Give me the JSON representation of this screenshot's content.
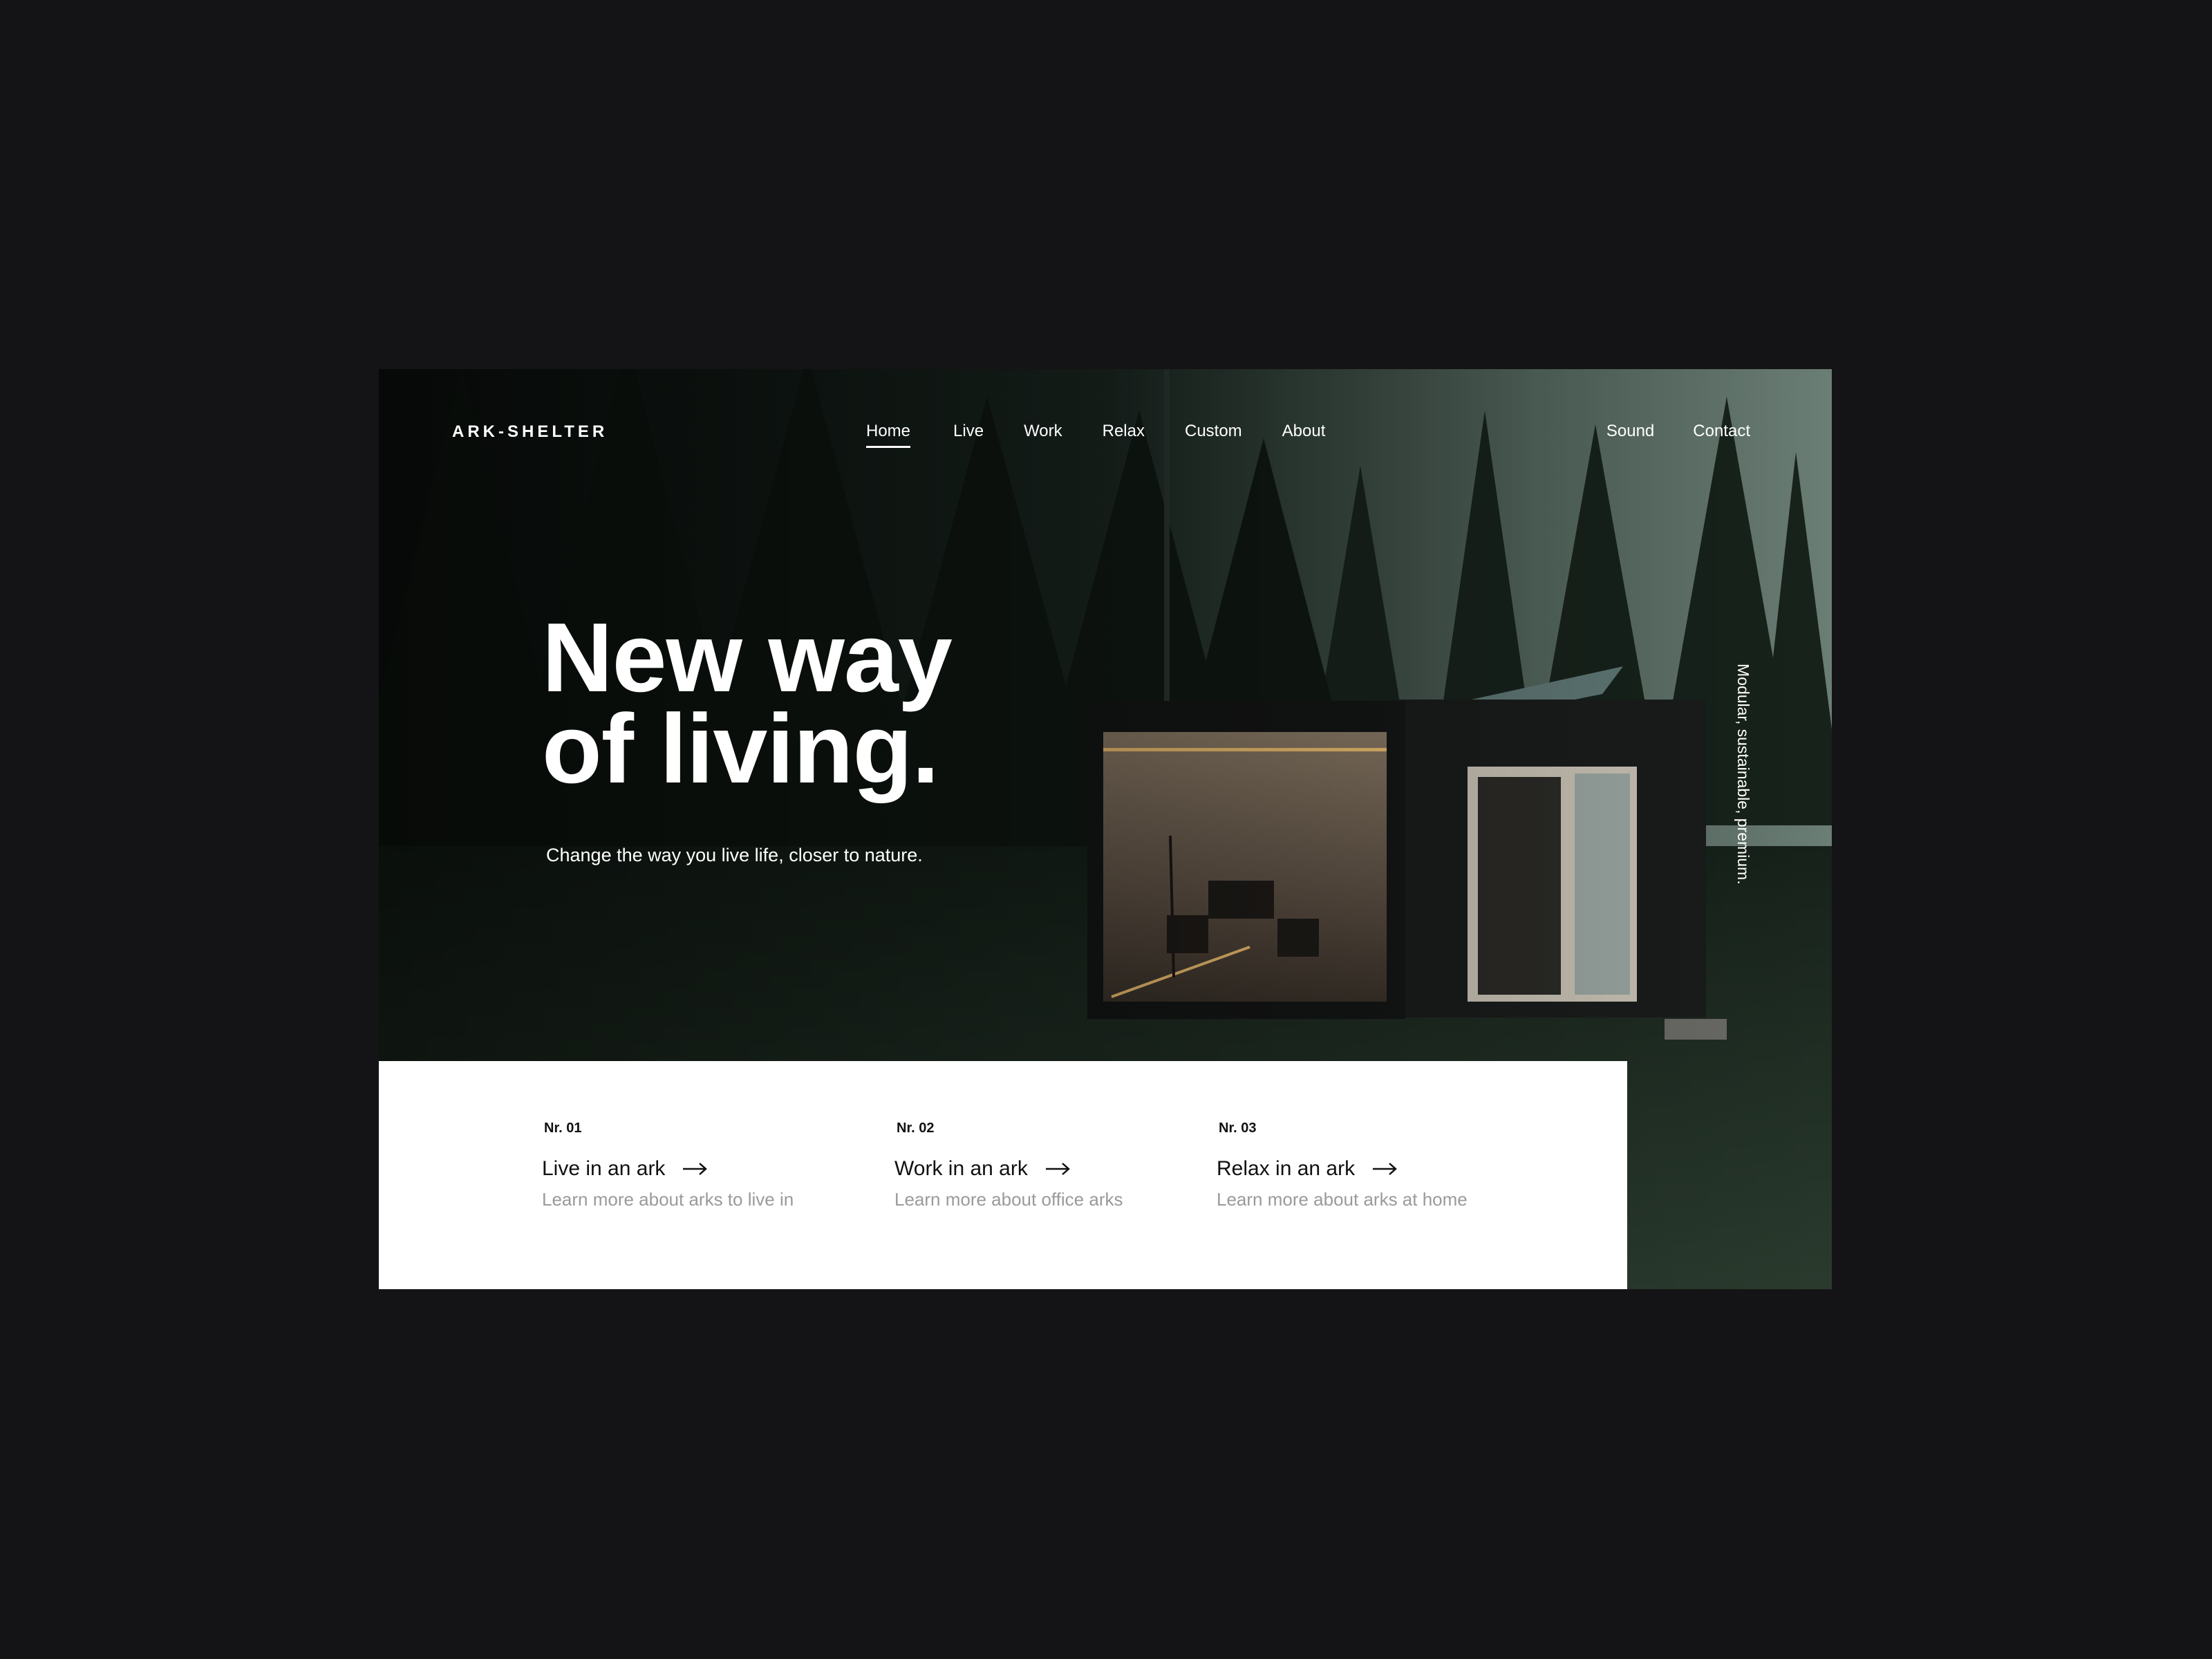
{
  "header": {
    "logo": "ARK-SHELTER",
    "nav": [
      {
        "label": "Home",
        "active": true
      },
      {
        "label": "Live"
      },
      {
        "label": "Work"
      },
      {
        "label": "Relax"
      },
      {
        "label": "Custom"
      },
      {
        "label": "About"
      }
    ],
    "right": {
      "sound": "Sound",
      "contact": "Contact"
    }
  },
  "hero": {
    "headline_line1": "New way",
    "headline_line2": "of living.",
    "subline": "Change the way you live life, closer to nature.",
    "vertical_tag": "Modular, sustainable, premium."
  },
  "cards": [
    {
      "num": "Nr. 01",
      "title": "Live in an ark",
      "desc": "Learn more about arks to live in",
      "icon": "arrow-right-icon"
    },
    {
      "num": "Nr. 02",
      "title": "Work in an ark",
      "desc": "Learn more about office arks",
      "icon": "arrow-right-icon"
    },
    {
      "num": "Nr. 03",
      "title": "Relax in an ark",
      "desc": "Learn more about arks at home",
      "icon": "arrow-right-icon"
    }
  ],
  "colors": {
    "page_bg": "#141416",
    "card_bg": "#ffffff",
    "text_light": "#ffffff",
    "text_dark": "#111111",
    "text_muted": "#9a9a9a",
    "interior_light": "#f0c070"
  }
}
